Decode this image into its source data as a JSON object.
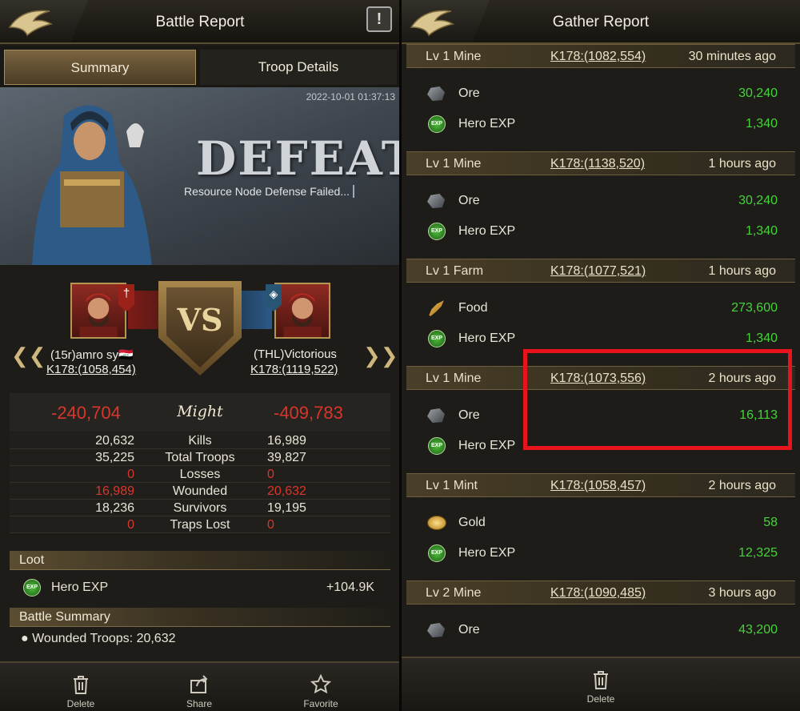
{
  "left": {
    "header": {
      "title": "Battle Report",
      "alert_icon": "alert-icon"
    },
    "tabs": [
      {
        "label": "Summary",
        "active": true
      },
      {
        "label": "Troop Details",
        "active": false
      }
    ],
    "banner": {
      "date": "2022-10-01 01:37:13",
      "result": "DEFEAT",
      "subtitle": "Resource Node Defense Failed..."
    },
    "vs_label": "VS",
    "attacker": {
      "name": "(15r)amro sy🇮🇶",
      "coords": "K178:(1058,454)"
    },
    "defender": {
      "name": "(THL)Victorious",
      "coords": "K178:(1119,522)"
    },
    "might": {
      "label": "Might",
      "left": "-240,704",
      "right": "-409,783"
    },
    "stats": [
      {
        "label": "Kills",
        "left": "20,632",
        "right": "16,989",
        "left_red": false,
        "right_red": false
      },
      {
        "label": "Total Troops",
        "left": "35,225",
        "right": "39,827",
        "left_red": false,
        "right_red": false
      },
      {
        "label": "Losses",
        "left": "0",
        "right": "0",
        "left_red": true,
        "right_red": true
      },
      {
        "label": "Wounded",
        "left": "16,989",
        "right": "20,632",
        "left_red": true,
        "right_red": true
      },
      {
        "label": "Survivors",
        "left": "18,236",
        "right": "19,195",
        "left_red": false,
        "right_red": false
      },
      {
        "label": "Traps Lost",
        "left": "0",
        "right": "0",
        "left_red": true,
        "right_red": true
      }
    ],
    "loot": {
      "title": "Loot",
      "item_label": "Hero EXP",
      "item_value": "+104.9K",
      "exp_badge": "EXP"
    },
    "battle_summary": {
      "title": "Battle Summary",
      "line": "Wounded Troops: 20,632"
    },
    "footer": [
      {
        "label": "Delete",
        "icon": "trash-icon"
      },
      {
        "label": "Share",
        "icon": "share-icon"
      },
      {
        "label": "Favorite",
        "icon": "star-icon"
      }
    ]
  },
  "right": {
    "header": {
      "title": "Gather Report"
    },
    "reports": [
      {
        "level": "Lv 1 Mine",
        "coords": "K178:(1082,554)",
        "time": "30 minutes ago",
        "items": [
          {
            "name": "Ore",
            "qty": "30,240",
            "icon": "ore"
          },
          {
            "name": "Hero EXP",
            "qty": "1,340",
            "icon": "exp"
          }
        ]
      },
      {
        "level": "Lv 1 Mine",
        "coords": "K178:(1138,520)",
        "time": "1 hours ago",
        "items": [
          {
            "name": "Ore",
            "qty": "30,240",
            "icon": "ore"
          },
          {
            "name": "Hero EXP",
            "qty": "1,340",
            "icon": "exp"
          }
        ]
      },
      {
        "level": "Lv 1 Farm",
        "coords": "K178:(1077,521)",
        "time": "1 hours ago",
        "items": [
          {
            "name": "Food",
            "qty": "273,600",
            "icon": "food"
          },
          {
            "name": "Hero EXP",
            "qty": "1,340",
            "icon": "exp"
          }
        ]
      },
      {
        "level": "Lv 1 Mine",
        "coords": "K178:(1073,556)",
        "time": "2 hours ago",
        "items": [
          {
            "name": "Ore",
            "qty": "16,113",
            "icon": "ore"
          },
          {
            "name": "Hero EXP",
            "qty": "",
            "icon": "exp"
          }
        ]
      },
      {
        "level": "Lv 1 Mint",
        "coords": "K178:(1058,457)",
        "time": "2 hours ago",
        "items": [
          {
            "name": "Gold",
            "qty": "58",
            "icon": "gold"
          },
          {
            "name": "Hero EXP",
            "qty": "12,325",
            "icon": "exp"
          }
        ]
      },
      {
        "level": "Lv 2 Mine",
        "coords": "K178:(1090,485)",
        "time": "3 hours ago",
        "items": [
          {
            "name": "Ore",
            "qty": "43,200",
            "icon": "ore"
          }
        ]
      }
    ],
    "footer": {
      "label": "Delete",
      "icon": "trash-icon"
    }
  },
  "colors": {
    "accent_gold": "#a58c5a",
    "loss_red": "#d9362b",
    "gain_green": "#45d33a",
    "highlight_red": "#e8131c"
  }
}
